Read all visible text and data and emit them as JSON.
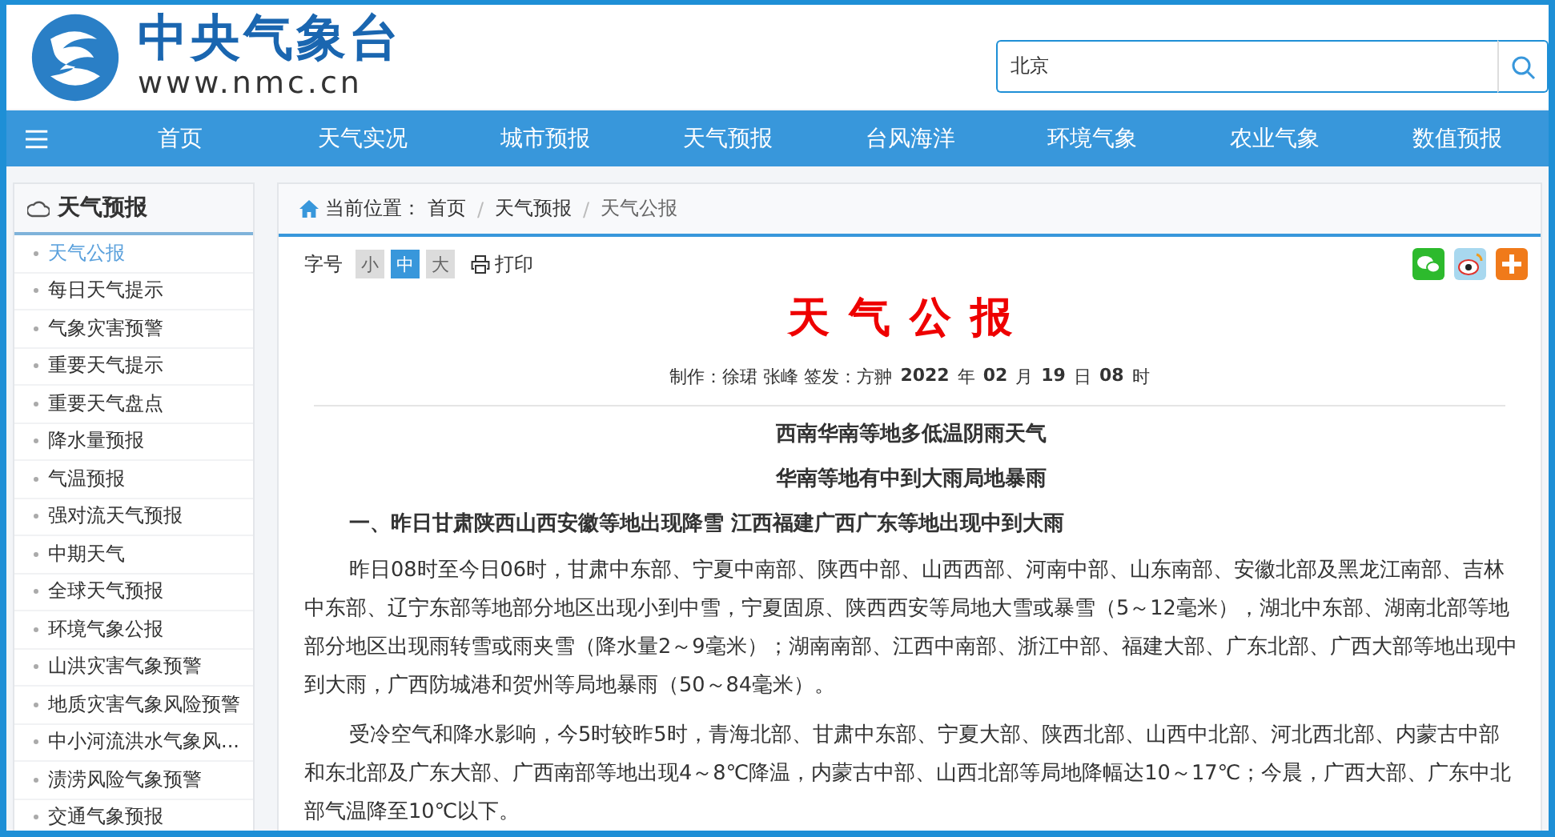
{
  "header": {
    "logo_title": "中央气象台",
    "logo_url": "www.nmc.cn",
    "search": {
      "value": "北京"
    }
  },
  "nav": [
    "首页",
    "天气实况",
    "城市预报",
    "天气预报",
    "台风海洋",
    "环境气象",
    "农业气象",
    "数值预报"
  ],
  "sidebar": {
    "title": "天气预报",
    "items": [
      {
        "label": "天气公报",
        "selected": true
      },
      {
        "label": "每日天气提示",
        "selected": false
      },
      {
        "label": "气象灾害预警",
        "selected": false
      },
      {
        "label": "重要天气提示",
        "selected": false
      },
      {
        "label": "重要天气盘点",
        "selected": false
      },
      {
        "label": "降水量预报",
        "selected": false
      },
      {
        "label": "气温预报",
        "selected": false
      },
      {
        "label": "强对流天气预报",
        "selected": false
      },
      {
        "label": "中期天气",
        "selected": false
      },
      {
        "label": "全球天气预报",
        "selected": false
      },
      {
        "label": "环境气象公报",
        "selected": false
      },
      {
        "label": "山洪灾害气象预警",
        "selected": false
      },
      {
        "label": "地质灾害气象风险预警",
        "selected": false
      },
      {
        "label": "中小河流洪水气象风...",
        "selected": false
      },
      {
        "label": "渍涝风险气象预警",
        "selected": false
      },
      {
        "label": "交通气象预报",
        "selected": false
      }
    ]
  },
  "breadcrumb": {
    "label": "当前位置：",
    "items": [
      "首页",
      "天气预报",
      "天气公报"
    ],
    "separator": "/"
  },
  "toolbar": {
    "font_label": "字号",
    "font_sizes": [
      {
        "label": "小",
        "selected": false
      },
      {
        "label": "中",
        "selected": true
      },
      {
        "label": "大",
        "selected": false
      }
    ],
    "print": "打印"
  },
  "article": {
    "title": "天气公报",
    "meta": "制作：徐珺 张峰  签发：方翀",
    "date": [
      {
        "kind": "num",
        "text": "2022"
      },
      {
        "kind": "unit",
        "text": "年"
      },
      {
        "kind": "num",
        "text": "02"
      },
      {
        "kind": "unit",
        "text": "月"
      },
      {
        "kind": "num",
        "text": "19"
      },
      {
        "kind": "unit",
        "text": "日"
      },
      {
        "kind": "num",
        "text": "08"
      },
      {
        "kind": "unit",
        "text": "时"
      }
    ],
    "blocks": [
      {
        "kind": "headline",
        "text": "西南华南等地多低温阴雨天气"
      },
      {
        "kind": "headline",
        "text": "华南等地有中到大雨局地暴雨"
      },
      {
        "kind": "section",
        "text": "一、昨日甘肃陕西山西安徽等地出现降雪 江西福建广西广东等地出现中到大雨"
      },
      {
        "kind": "paragraph",
        "text": "昨日08时至今日06时，甘肃中东部、宁夏中南部、陕西中部、山西西部、河南中部、山东南部、安徽北部及黑龙江南部、吉林中东部、辽宁东部等地部分地区出现小到中雪，宁夏固原、陕西西安等局地大雪或暴雪（5～12毫米），湖北中东部、湖南北部等地部分地区出现雨转雪或雨夹雪（降水量2～9毫米）；湖南南部、江西中南部、浙江中部、福建大部、广东北部、广西大部等地出现中到大雨，广西防城港和贺州等局地暴雨（50～84毫米）。"
      },
      {
        "kind": "paragraph",
        "text": "受冷空气和降水影响，今5时较昨5时，青海北部、甘肃中东部、宁夏大部、陕西北部、山西中北部、河北西北部、内蒙古中部和东北部及广东大部、广西南部等地出现4～8℃降温，内蒙古中部、山西北部等局地降幅达10～17℃；今晨，广西大部、广东中北部气温降至10℃以下。"
      }
    ]
  }
}
